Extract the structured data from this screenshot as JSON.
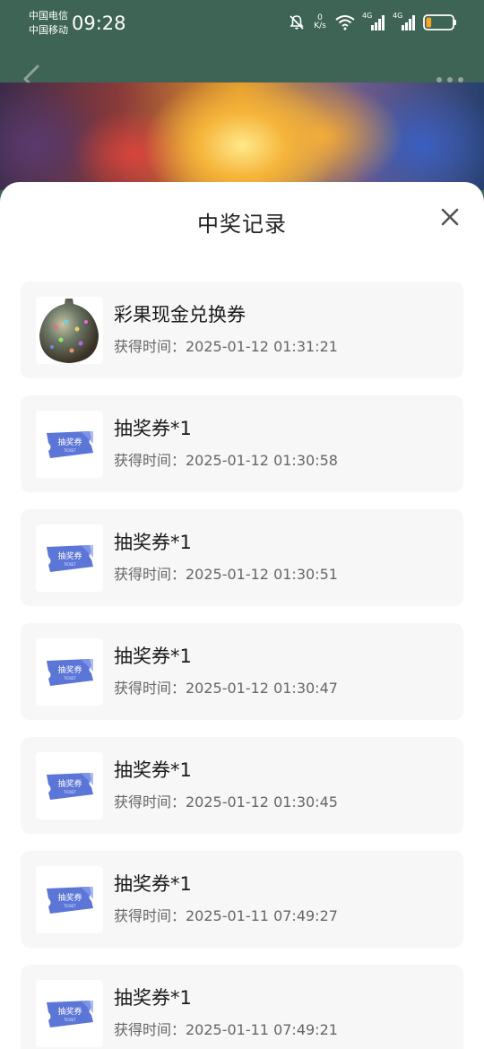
{
  "status_bar": {
    "carrier_1": "中国电信",
    "carrier_2": "中国移动",
    "time": "09:28",
    "net_speed_value": "0",
    "net_speed_unit": "K/s",
    "signal_1": "4G",
    "signal_2": "4G",
    "battery_level": 0.2
  },
  "sheet": {
    "title": "中奖记录"
  },
  "ticket_label": "抽奖券",
  "ticket_sub": "TICKET",
  "records": [
    {
      "name": "彩果现金兑换券",
      "time": "获得时间：2025-01-12 01:31:21",
      "icon": "gem-egg-icon"
    },
    {
      "name": "抽奖券*1",
      "time": "获得时间：2025-01-12 01:30:58",
      "icon": "ticket-icon"
    },
    {
      "name": "抽奖券*1",
      "time": "获得时间：2025-01-12 01:30:51",
      "icon": "ticket-icon"
    },
    {
      "name": "抽奖券*1",
      "time": "获得时间：2025-01-12 01:30:47",
      "icon": "ticket-icon"
    },
    {
      "name": "抽奖券*1",
      "time": "获得时间：2025-01-12 01:30:45",
      "icon": "ticket-icon"
    },
    {
      "name": "抽奖券*1",
      "time": "获得时间：2025-01-11 07:49:27",
      "icon": "ticket-icon"
    },
    {
      "name": "抽奖券*1",
      "time": "获得时间：2025-01-11 07:49:21",
      "icon": "ticket-icon"
    }
  ],
  "colors": {
    "header_bg": "#3e6456",
    "card_bg": "#f7f7f7",
    "ticket_blue": "#5b76d6"
  }
}
